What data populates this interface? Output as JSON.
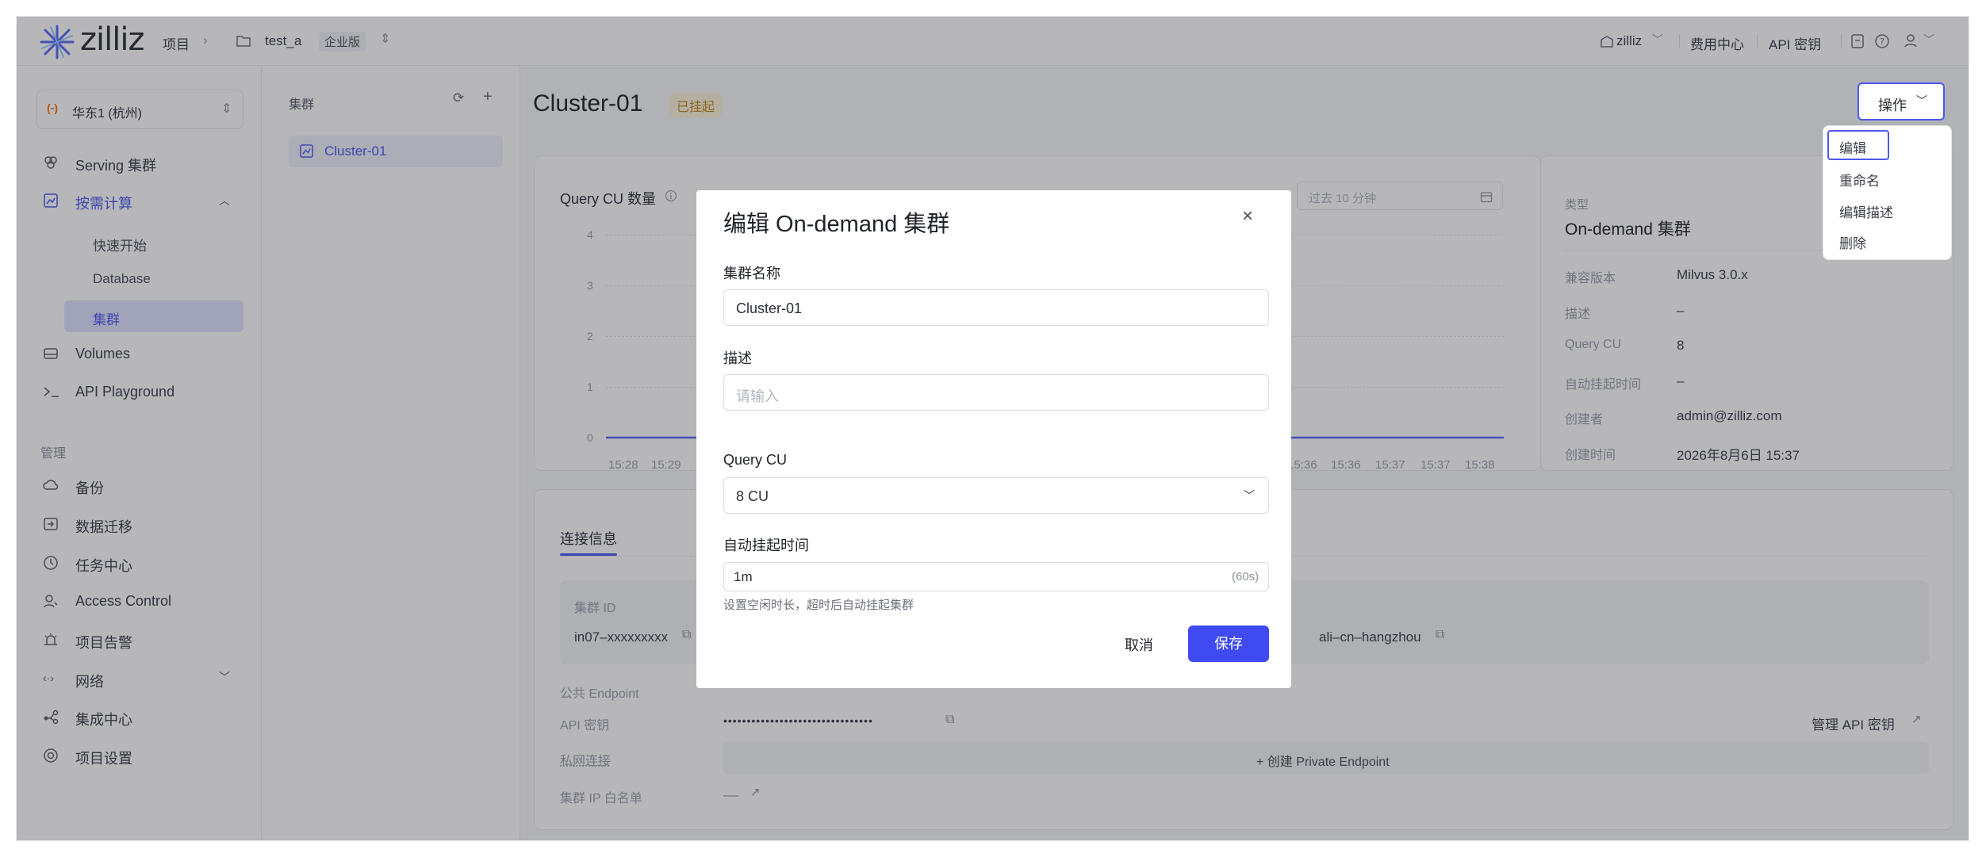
{
  "topbar": {
    "logo": "zilliz",
    "project_label": "项目",
    "project_name": "test_a",
    "edition": "企业版",
    "org": "zilliz",
    "billing": "费用中心",
    "api_keys": "API 密钥"
  },
  "sidebar": {
    "region": "华东1 (杭州)",
    "items": [
      {
        "label": "Serving 集群",
        "icon": "serving-icon"
      },
      {
        "label": "按需计算",
        "icon": "compute-icon"
      },
      {
        "label": "Volumes",
        "icon": "volumes-icon"
      },
      {
        "label": "API Playground",
        "icon": "terminal-icon"
      }
    ],
    "sub_items": [
      "快速开始",
      "Database",
      "集群"
    ],
    "manage_title": "管理",
    "manage_items": [
      {
        "label": "备份",
        "icon": "backup-icon"
      },
      {
        "label": "数据迁移",
        "icon": "migration-icon"
      },
      {
        "label": "任务中心",
        "icon": "task-icon"
      },
      {
        "label": "Access Control",
        "icon": "access-icon"
      },
      {
        "label": "项目告警",
        "icon": "alert-icon"
      },
      {
        "label": "网络",
        "icon": "network-icon"
      },
      {
        "label": "集成中心",
        "icon": "integration-icon"
      },
      {
        "label": "项目设置",
        "icon": "settings-icon"
      }
    ]
  },
  "cluster_list": {
    "title": "集群",
    "items": [
      "Cluster-01"
    ]
  },
  "main": {
    "title": "Cluster-01",
    "status": "已挂起",
    "actions_label": "操作",
    "actions_menu": [
      "编辑",
      "重命名",
      "编辑描述",
      "删除"
    ],
    "chart_title": "Query CU 数量",
    "time_range": "过去 10 分钟",
    "info": {
      "type_label": "类型",
      "type_value": "On-demand 集群",
      "rows": [
        {
          "k": "兼容版本",
          "v": "Milvus 3.0.x"
        },
        {
          "k": "描述",
          "v": "–"
        },
        {
          "k": "Query CU",
          "v": "8"
        },
        {
          "k": "自动挂起时间",
          "v": "–"
        },
        {
          "k": "创建者",
          "v": "admin@zilliz.com"
        },
        {
          "k": "创建时间",
          "v": "2026年8月6日 15:37"
        }
      ]
    },
    "connection": {
      "tab": "连接信息",
      "cluster_id_label": "集群 ID",
      "cluster_id": "in07–xxxxxxxxx",
      "region_value": "ali–cn–hangzhou",
      "public_endpoint_label": "公共 Endpoint",
      "api_key_label": "API 密钥",
      "api_key_value": "••••••••••••••••••••••••••••••••",
      "manage_api_key": "管理 API 密钥",
      "private_link_label": "私网连接",
      "create_private_endpoint": "+ 创建 Private Endpoint",
      "ip_whitelist_label": "集群 IP 白名单",
      "ip_whitelist_value": "––"
    }
  },
  "chart_data": {
    "type": "line",
    "title": "Query CU 数量",
    "ylim": [
      0,
      4
    ],
    "yticks": [
      "4",
      "3",
      "2",
      "1",
      "0"
    ],
    "x_left": [
      "15:28",
      "15:29"
    ],
    "x_right": [
      "15:36",
      "15:36",
      "15:37",
      "15:37",
      "15:38"
    ],
    "series": [
      {
        "values": [
          0,
          0,
          0,
          0,
          0,
          0,
          0
        ]
      }
    ]
  },
  "modal": {
    "title": "编辑 On-demand 集群",
    "name_label": "集群名称",
    "name_value": "Cluster-01",
    "desc_label": "描述",
    "desc_placeholder": "请输入",
    "cu_label": "Query CU",
    "cu_value": "8 CU",
    "suspend_label": "自动挂起时间",
    "suspend_value": "1m",
    "suspend_hint_unit": "(60s)",
    "suspend_help": "设置空闲时长，超时后自动挂起集群",
    "cancel": "取消",
    "save": "保存"
  },
  "colors": {
    "accent": "#3f4bf0",
    "status_bg": "#fdf3dc",
    "status_text": "#c08a1a"
  }
}
